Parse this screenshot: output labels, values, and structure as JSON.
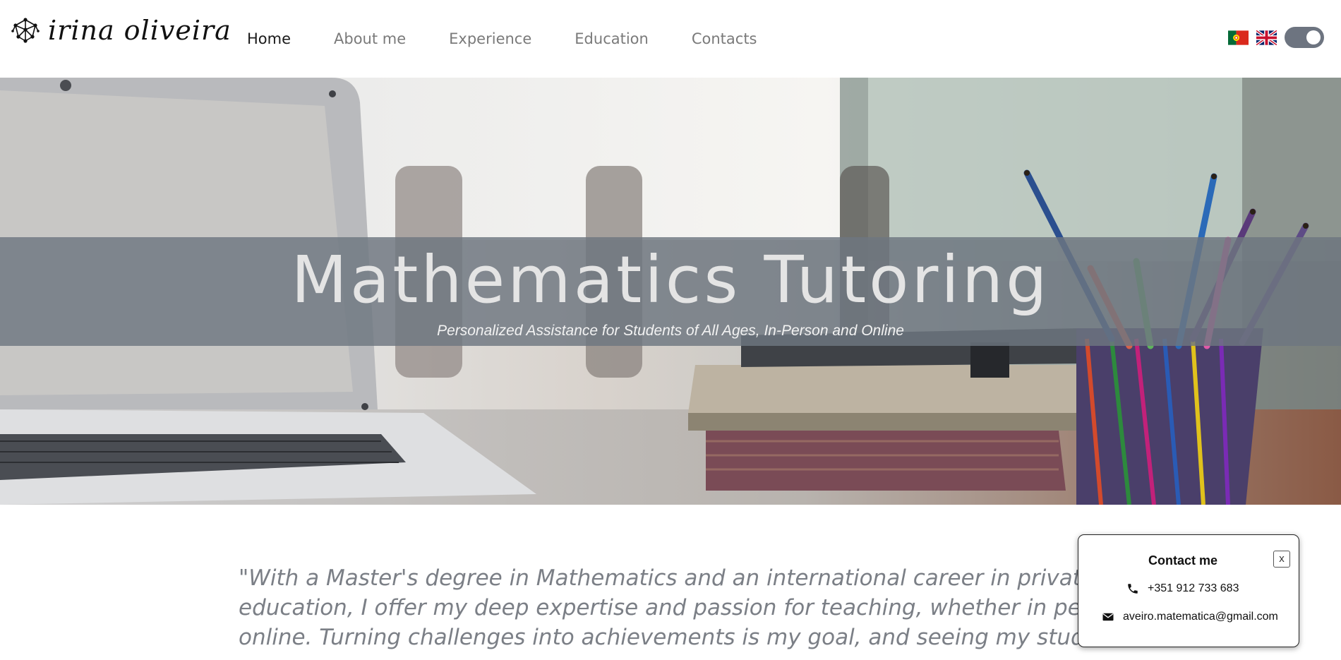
{
  "header": {
    "logo_text": "irina oliveira",
    "nav": [
      {
        "label": "Home",
        "active": true
      },
      {
        "label": "About me",
        "active": false
      },
      {
        "label": "Experience",
        "active": false
      },
      {
        "label": "Education",
        "active": false
      },
      {
        "label": "Contacts",
        "active": false
      }
    ],
    "languages": [
      {
        "icon": "portugal-flag-icon"
      },
      {
        "icon": "uk-flag-icon"
      }
    ],
    "theme_toggle": {
      "icon": "theme-toggle",
      "on": true
    }
  },
  "hero": {
    "title": "Mathematics Tutoring",
    "subtitle": "Personalized Assistance for Students of All Ages, In-Person and Online"
  },
  "intro": {
    "lines": [
      "\"With a Master's degree in Mathematics and an international career in private",
      "education, I offer my deep expertise and passion for teaching, whether in person or",
      "online. Turning challenges into achievements is my goal, and seeing my students"
    ]
  },
  "contact_card": {
    "title": "Contact me",
    "close_label": "x",
    "phone": "+351 912 733 683",
    "email": "aveiro.matematica@gmail.com"
  },
  "colors": {
    "hero_band": "#6e7680",
    "toggle": "#6d7480",
    "nav_active": "#1a1a1a",
    "nav_inactive": "#7a7a7a",
    "quote_text": "#7b7f86"
  }
}
